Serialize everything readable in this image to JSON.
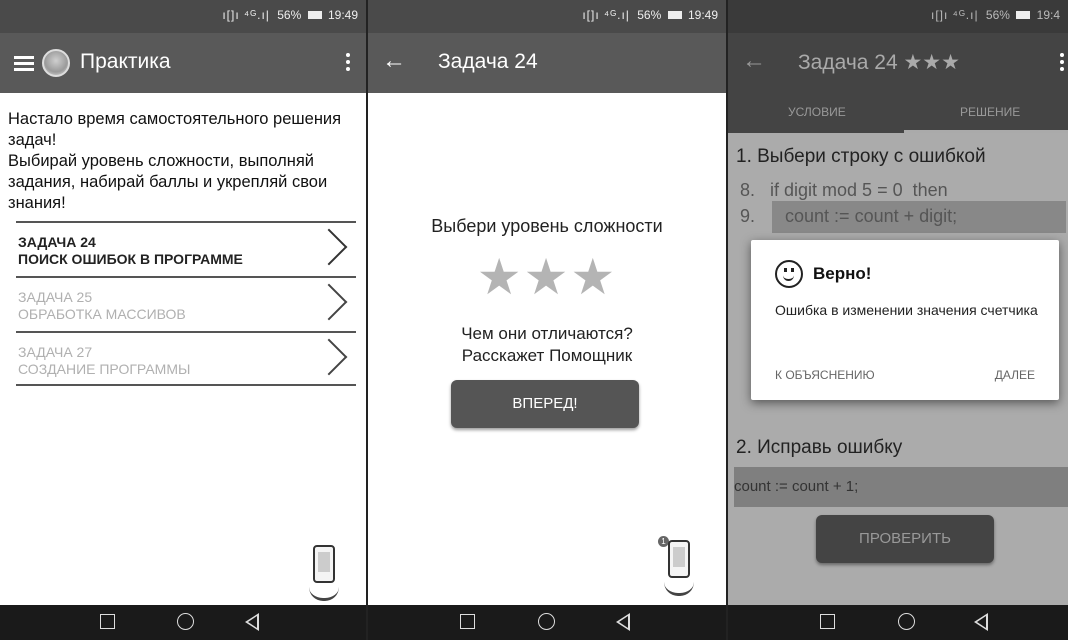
{
  "status": {
    "signal": "ı[]ı ⁴ᴳ.ı|",
    "battery": "56%",
    "time1": "19:49",
    "time2": "19:49",
    "time3": "19:4"
  },
  "screen1": {
    "title": "Практика",
    "intro": [
      "Настало время самостоятельного решения задач!",
      "Выбирай уровень сложности, выполняй задания, набирай баллы и укрепляй свои знания!"
    ],
    "tasks": [
      {
        "number": "ЗАДАЧА 24",
        "name": "ПОИСК ОШИБОК В ПРОГРАММЕ",
        "enabled": true
      },
      {
        "number": "ЗАДАЧА 25",
        "name": "ОБРАБОТКА МАССИВОВ",
        "enabled": false
      },
      {
        "number": "ЗАДАЧА 27",
        "name": "СОЗДАНИЕ ПРОГРАММЫ",
        "enabled": false
      }
    ]
  },
  "screen2": {
    "title": "Задача 24",
    "prompt": "Выбери уровень сложности",
    "stars": "★★★",
    "question_line1": "Чем они отличаются?",
    "question_line2": "Расскажет Помощник",
    "forward_button": "ВПЕРЕД!",
    "helper_badge": "1"
  },
  "screen3": {
    "title": "Задача 24 ★★★",
    "tabs": [
      "УСЛОВИЕ",
      "РЕШЕНИЕ"
    ],
    "step1": "1. Выбери строку с ошибкой",
    "code": [
      {
        "num": "8.",
        "text": "   if digit mod 5 = 0  then"
      },
      {
        "num": "9.",
        "text": "      count := count + digit;"
      }
    ],
    "step2": "2. Исправь ошибку",
    "answer": "count := count + 1;",
    "check_button": "ПРОВЕРИТЬ",
    "dialog": {
      "title": "Верно!",
      "message": "Ошибка в изменении значения счетчика",
      "explain_button": "К ОБЪЯСНЕНИЮ",
      "next_button": "ДАЛЕЕ"
    }
  }
}
